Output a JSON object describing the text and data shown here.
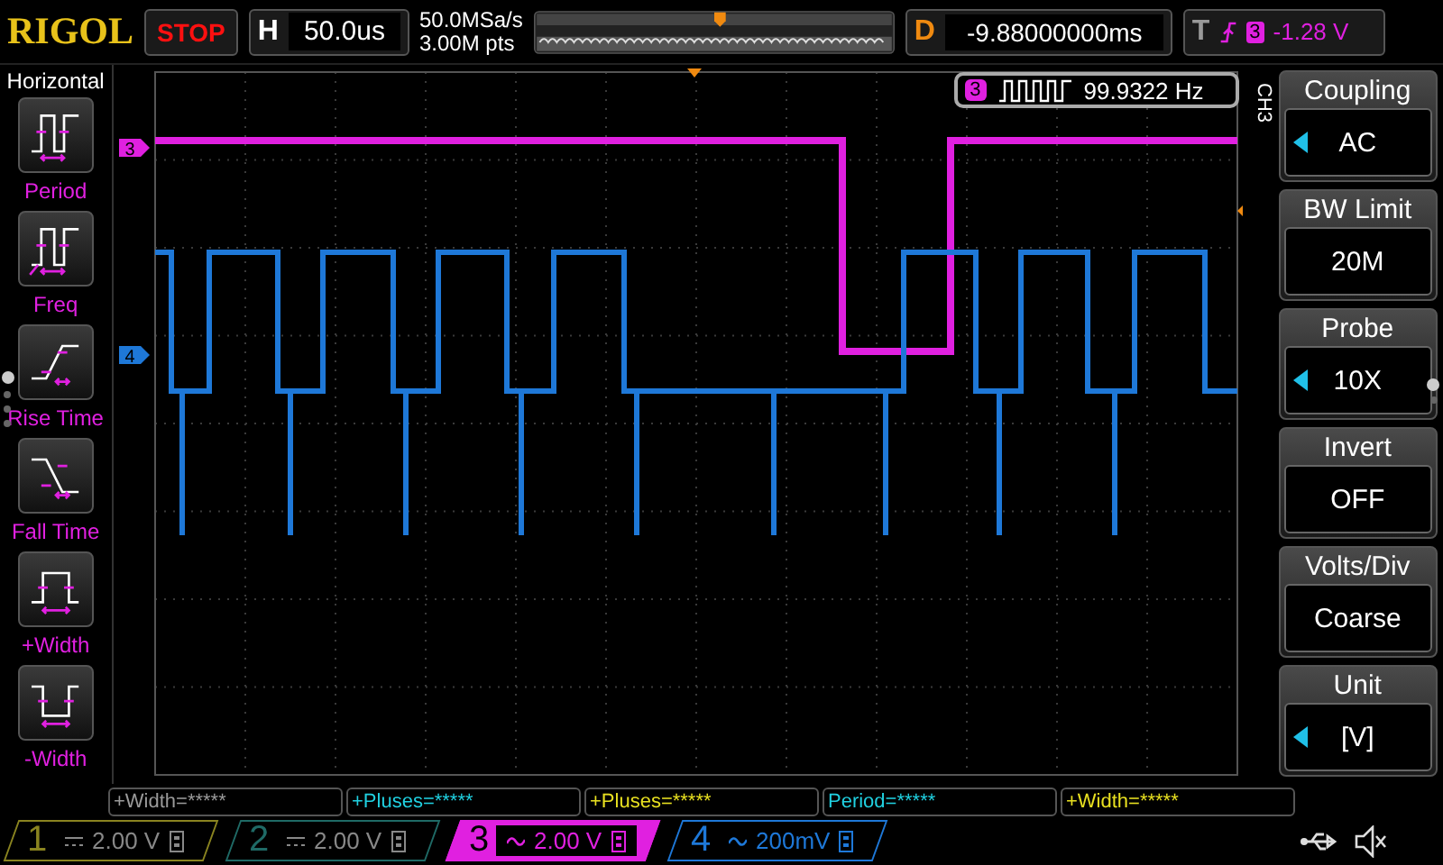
{
  "top_bar": {
    "logo": "RIGOL",
    "run_state": "STOP",
    "horizontal": {
      "label": "H",
      "timebase": "50.0us"
    },
    "acquisition": {
      "sample_rate": "50.0MSa/s",
      "memory_depth": "3.00M pts"
    },
    "delay": {
      "label": "D",
      "value": "-9.88000000ms"
    },
    "trigger": {
      "label": "T",
      "source": "3",
      "level": "-1.28 V"
    }
  },
  "sidebar": {
    "title": "Horizontal",
    "items": [
      {
        "label": "Period",
        "kind": "period"
      },
      {
        "label": "Freq",
        "kind": "freq"
      },
      {
        "label": "Rise Time",
        "kind": "rise"
      },
      {
        "label": "Fall Time",
        "kind": "fall"
      },
      {
        "label": "+Width",
        "kind": "pwidth"
      },
      {
        "label": "-Width",
        "kind": "nwidth"
      }
    ],
    "pages": [
      {
        "selected": true
      },
      {
        "selected": false
      },
      {
        "selected": false
      },
      {
        "selected": false
      }
    ]
  },
  "display": {
    "channel_markers": [
      {
        "label": "3",
        "color": "#e020e0"
      },
      {
        "label": "4",
        "color": "#1e78d8"
      }
    ],
    "measurement": {
      "source": "3",
      "value": "99.9322 Hz"
    }
  },
  "menu": {
    "title": "CH3",
    "items": [
      {
        "title": "Coupling",
        "value": "AC",
        "has_options": true
      },
      {
        "title": "BW Limit",
        "value": "20M",
        "has_options": false
      },
      {
        "title": "Probe",
        "value": "10X",
        "has_options": true
      },
      {
        "title": "Invert",
        "value": "OFF",
        "has_options": false
      },
      {
        "title": "Volts/Div",
        "value": "Coarse",
        "has_options": false
      },
      {
        "title": "Unit",
        "value": "[V]",
        "has_options": true
      }
    ],
    "pages": [
      {
        "selected": true
      },
      {
        "selected": false
      }
    ]
  },
  "measurements": [
    {
      "text": "+Width=*****",
      "color": "#9a9a9a"
    },
    {
      "text": "+Pluses=*****",
      "color": "#20d0e0"
    },
    {
      "text": "+Pluses=*****",
      "color": "#e8e020"
    },
    {
      "text": "Period=*****",
      "color": "#20d0e0"
    },
    {
      "text": "+Width=*****",
      "color": "#e8e020"
    }
  ],
  "channels": [
    {
      "number": "1",
      "kind": "dc",
      "scale": "2.00 V",
      "color": "#8a8420",
      "enabled": false,
      "selected": false
    },
    {
      "number": "2",
      "kind": "dc",
      "scale": "2.00 V",
      "color": "#1f6a66",
      "enabled": false,
      "selected": false
    },
    {
      "number": "3",
      "kind": "ac",
      "scale": "2.00 V",
      "color": "#e020e0",
      "enabled": true,
      "selected": true
    },
    {
      "number": "4",
      "kind": "ac",
      "scale": "200mV",
      "color": "#1e78d8",
      "enabled": true,
      "selected": false
    }
  ]
}
